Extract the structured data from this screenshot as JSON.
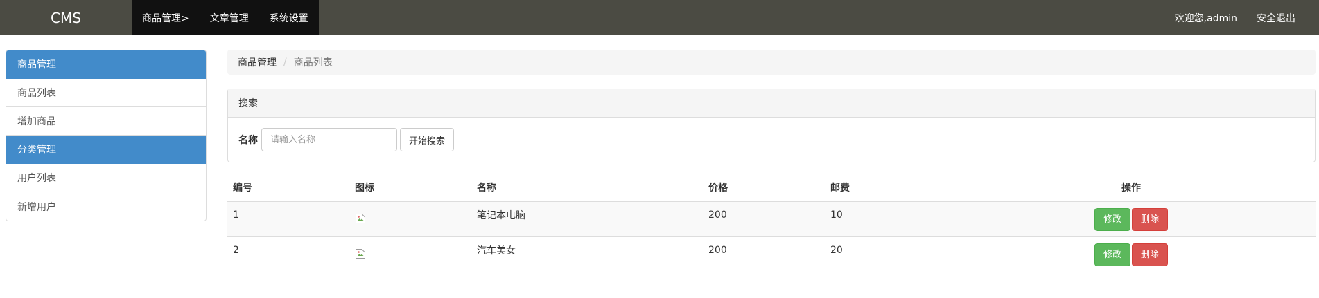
{
  "brand": "CMS",
  "top_nav": [
    "商品管理>",
    "文章管理",
    "系统设置"
  ],
  "user": {
    "welcome": "欢迎您,admin",
    "logout": "安全退出"
  },
  "sidebar": {
    "items": [
      {
        "label": "商品管理",
        "active": true
      },
      {
        "label": "商品列表"
      },
      {
        "label": "增加商品"
      },
      {
        "label": "分类管理",
        "active": true
      },
      {
        "label": "用户列表"
      },
      {
        "label": "新增用户"
      }
    ]
  },
  "breadcrumb": [
    "商品管理",
    "/",
    "商品列表"
  ],
  "search": {
    "title": "搜索",
    "label": "名称",
    "placeholder": "请输入名称",
    "button": "开始搜索"
  },
  "table": {
    "headers": [
      "编号",
      "图标",
      "名称",
      "价格",
      "邮费",
      "操作"
    ],
    "rows": [
      {
        "id": "1",
        "name": "笔记本电脑",
        "price": "200",
        "postage": "10"
      },
      {
        "id": "2",
        "name": "汽车美女",
        "price": "200",
        "postage": "20"
      }
    ],
    "edit_label": "修改",
    "delete_label": "删除"
  },
  "colors": {
    "navbar": "#4b4b43",
    "topnav_active": "#111111",
    "sidebar_active": "#428bca",
    "edit_button": "#5cb85c",
    "delete_button": "#d9534f"
  }
}
